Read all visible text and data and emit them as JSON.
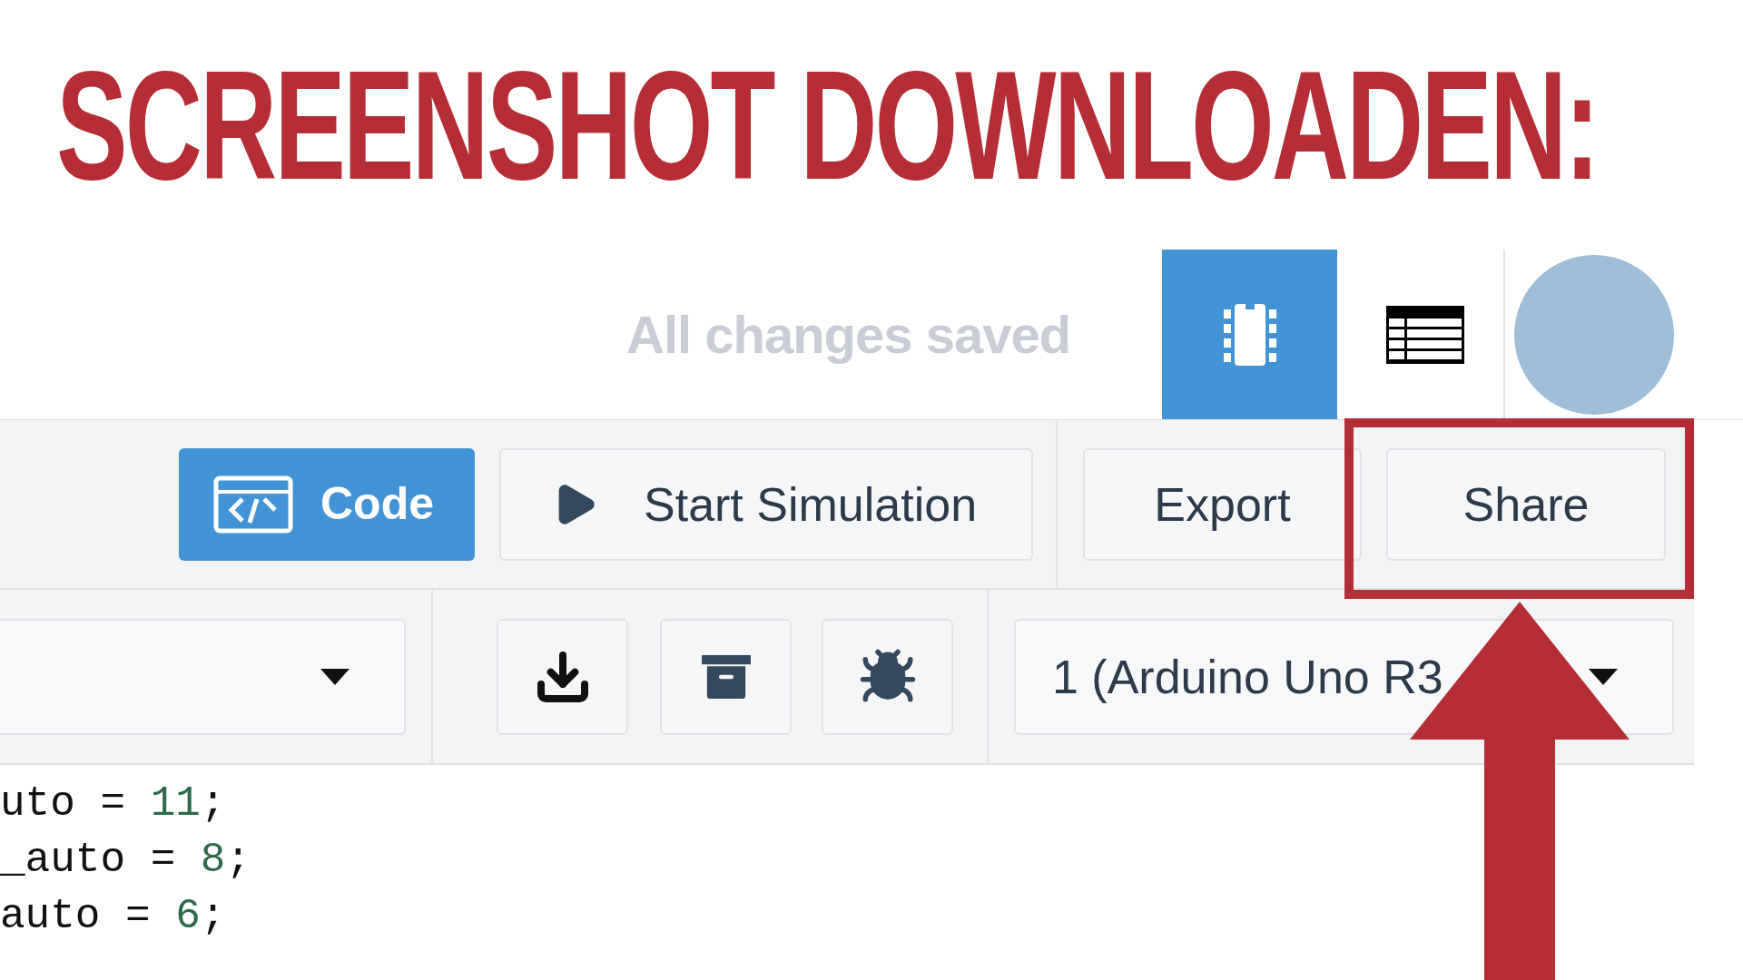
{
  "heading": "SCREENSHOT DOWNLOADEN:",
  "top_bar": {
    "status": "All changes saved",
    "view_buttons": [
      {
        "kind": "circuit",
        "selected": true
      },
      {
        "kind": "table",
        "selected": false
      }
    ]
  },
  "toolbar": {
    "code_button": "Code",
    "simulation_button": "Start Simulation",
    "export_button": "Export",
    "share_button": "Share"
  },
  "editor_bar": {
    "board_select": "1 (Arduino Uno R3"
  },
  "code": [
    {
      "prefix": "uto = ",
      "value": "11",
      "suffix": ";"
    },
    {
      "prefix": "_auto = ",
      "value": "8",
      "suffix": ";"
    },
    {
      "prefix": "auto = ",
      "value": "6",
      "suffix": ";"
    }
  ]
}
